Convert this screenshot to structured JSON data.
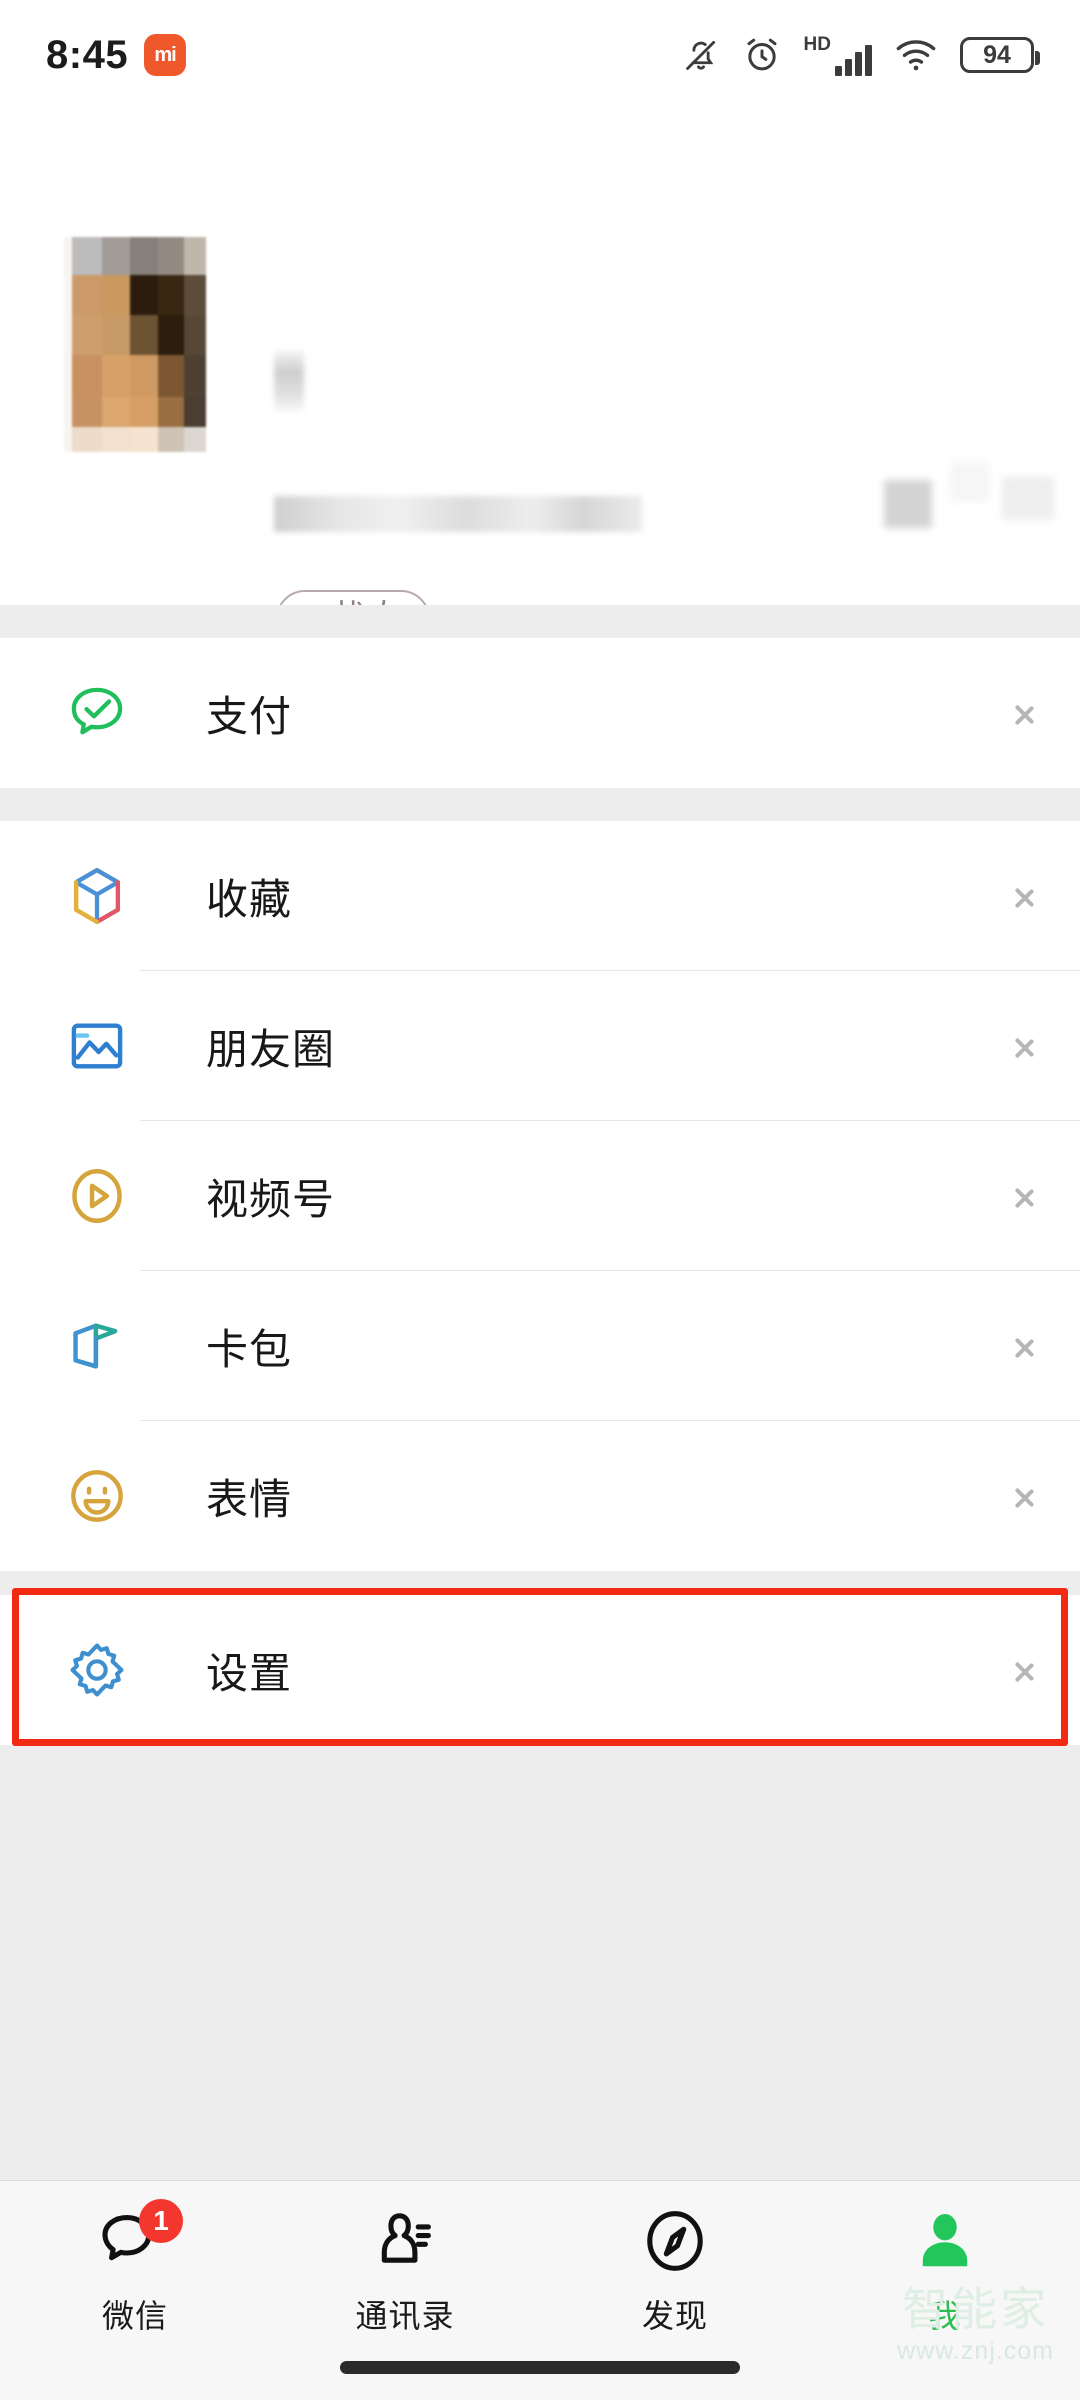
{
  "statusbar": {
    "time": "8:45",
    "brand_badge": "mi",
    "hd_label": "HD",
    "battery_level": "94",
    "icons": [
      "mute-bell-icon",
      "alarm-clock-icon",
      "hd-icon",
      "signal-bars-icon",
      "wifi-icon",
      "battery-icon"
    ]
  },
  "profile": {
    "name": "",
    "wechat_id": "",
    "status_button": {
      "plus": "+",
      "label": "状态"
    }
  },
  "groups": [
    {
      "rows": [
        {
          "label": "支付",
          "icon": "pay-icon",
          "icon_color": "#21bf5b"
        }
      ]
    },
    {
      "rows": [
        {
          "label": "收藏",
          "icon": "favorites-icon",
          "icon_color": "#4a90d9"
        },
        {
          "label": "朋友圈",
          "icon": "moments-icon",
          "icon_color": "#2f7fd1"
        },
        {
          "label": "视频号",
          "icon": "channels-icon",
          "icon_color": "#d6a43c"
        },
        {
          "label": "卡包",
          "icon": "cards-icon",
          "icon_color": "#3f93cf"
        },
        {
          "label": "表情",
          "icon": "stickers-icon",
          "icon_color": "#d6a43c"
        }
      ]
    },
    {
      "rows": [
        {
          "label": "设置",
          "icon": "settings-gear-icon",
          "icon_color": "#3f8fcf",
          "highlighted": true
        }
      ]
    }
  ],
  "annotation": {
    "color": "#f22a13",
    "target": "设置"
  },
  "tabbar": {
    "tabs": [
      {
        "label": "微信",
        "icon": "chat-bubbles-icon",
        "badge": "1",
        "active": false
      },
      {
        "label": "通讯录",
        "icon": "contacts-icon",
        "badge": "",
        "active": false
      },
      {
        "label": "发现",
        "icon": "discover-compass-icon",
        "badge": "",
        "active": false
      },
      {
        "label": "我",
        "icon": "me-person-icon",
        "badge": "",
        "active": true
      }
    ],
    "active_color": "#2fbb4f"
  },
  "watermark": {
    "text": "智能家",
    "url": "www.znj.com"
  }
}
